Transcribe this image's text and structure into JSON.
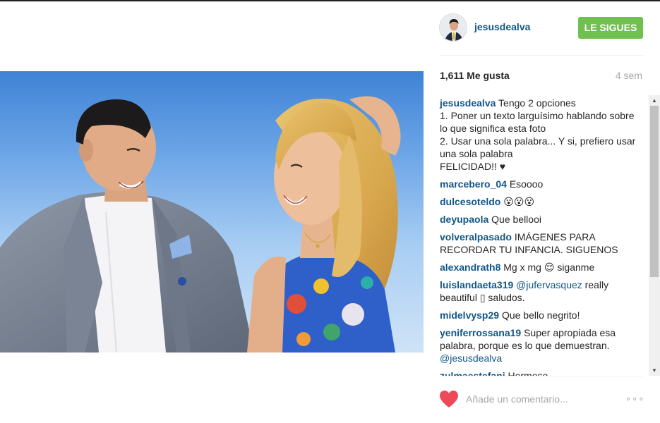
{
  "post": {
    "username": "jesusdealva",
    "follow_label": "LE SIGUES",
    "likes": "1,611 Me gusta",
    "time": "4 sem",
    "caption": {
      "user": "jesusdealva",
      "lines": [
        "Tengo 2 opciones",
        "1. Poner un texto larguísimo hablando sobre lo que significa esta foto",
        "2. Usar una sola palabra... Y si, prefiero usar una sola palabra",
        "FELICIDAD!! ♥"
      ]
    },
    "comments": [
      {
        "user": "marcebero_04",
        "text": "Esoooo"
      },
      {
        "user": "dulcesoteldo",
        "text": "😮😮😮"
      },
      {
        "user": "deyupaola",
        "text": "Que bellooi"
      },
      {
        "user": "volveralpasado",
        "text": "IMÁGENES PARA RECORDAR TU INFANCIA. SIGUENOS"
      },
      {
        "user": "alexandrath8",
        "text": "Mg x mg 😌 siganme"
      },
      {
        "user": "luislandaeta319",
        "mention": "@jufervasquez",
        "text": "really beautiful ▯ saludos."
      },
      {
        "user": "midelvysp29",
        "text": "Que bello negrito!"
      },
      {
        "user": "yeniferrossana19",
        "text": "Super apropiada esa palabra, porque es lo que demuestran.",
        "mention_after": "@jesusdealva"
      },
      {
        "user": "zulmaestefani",
        "text": "Hermoso"
      }
    ],
    "comment_placeholder": "Añade un comentario...",
    "more_label": "∘∘∘"
  },
  "colors": {
    "link": "#125688",
    "follow_bg": "#70c050",
    "heart": "#ed4956",
    "muted": "#a5a7aa"
  },
  "icons": {
    "heart": "heart-icon",
    "scroll_up": "scroll-up-arrow-icon",
    "scroll_down": "scroll-down-arrow-icon"
  }
}
